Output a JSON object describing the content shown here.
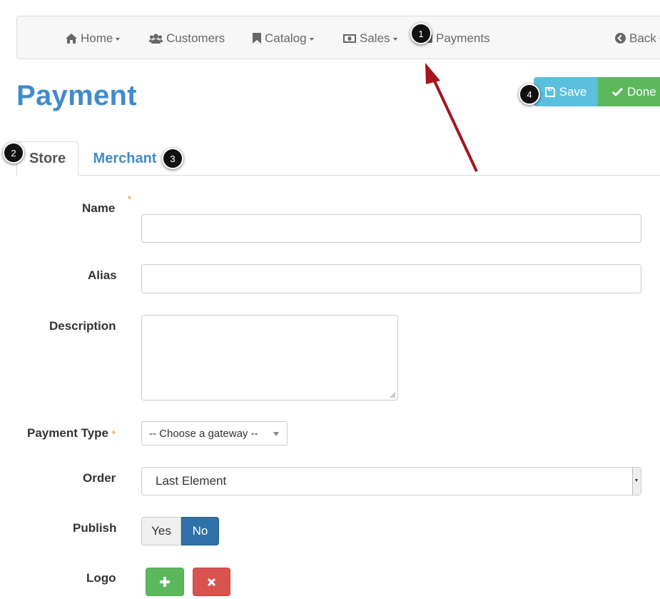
{
  "navbar": {
    "items": [
      {
        "label": "Home",
        "icon": "home-icon",
        "has_caret": true
      },
      {
        "label": "Customers",
        "icon": "users-icon",
        "has_caret": false
      },
      {
        "label": "Catalog",
        "icon": "bookmark-icon",
        "has_caret": true
      },
      {
        "label": "Sales",
        "icon": "money-icon",
        "has_caret": true
      },
      {
        "label": "Payments",
        "icon": "credit-card-icon",
        "has_caret": false
      },
      {
        "label": "Back",
        "icon": "chevron-circle-left-icon",
        "has_caret": true
      }
    ]
  },
  "page": {
    "title": "Payment"
  },
  "toolbar": {
    "save_label": "Save",
    "done_label": "Done"
  },
  "tabs": [
    {
      "label": "Store",
      "active": true
    },
    {
      "label": "Merchant",
      "active": false
    }
  ],
  "form": {
    "name_label": "Name",
    "name_value": "",
    "alias_label": "Alias",
    "alias_value": "",
    "description_label": "Description",
    "description_value": "",
    "payment_type_label": "Payment Type",
    "payment_type_value": "-- Choose a gateway --",
    "order_label": "Order",
    "order_value": "Last Element",
    "publish_label": "Publish",
    "publish_yes": "Yes",
    "publish_no": "No",
    "publish_selected": "No",
    "logo_label": "Logo",
    "required_mark": "*"
  },
  "callouts": [
    "1",
    "2",
    "3",
    "4"
  ],
  "colors": {
    "primary": "#428bca",
    "info": "#5bc0de",
    "success": "#5cb85c",
    "danger": "#d9534f",
    "publish_active": "#3071a9",
    "arrow": "#a3151c",
    "required": "#f0ad4e"
  }
}
